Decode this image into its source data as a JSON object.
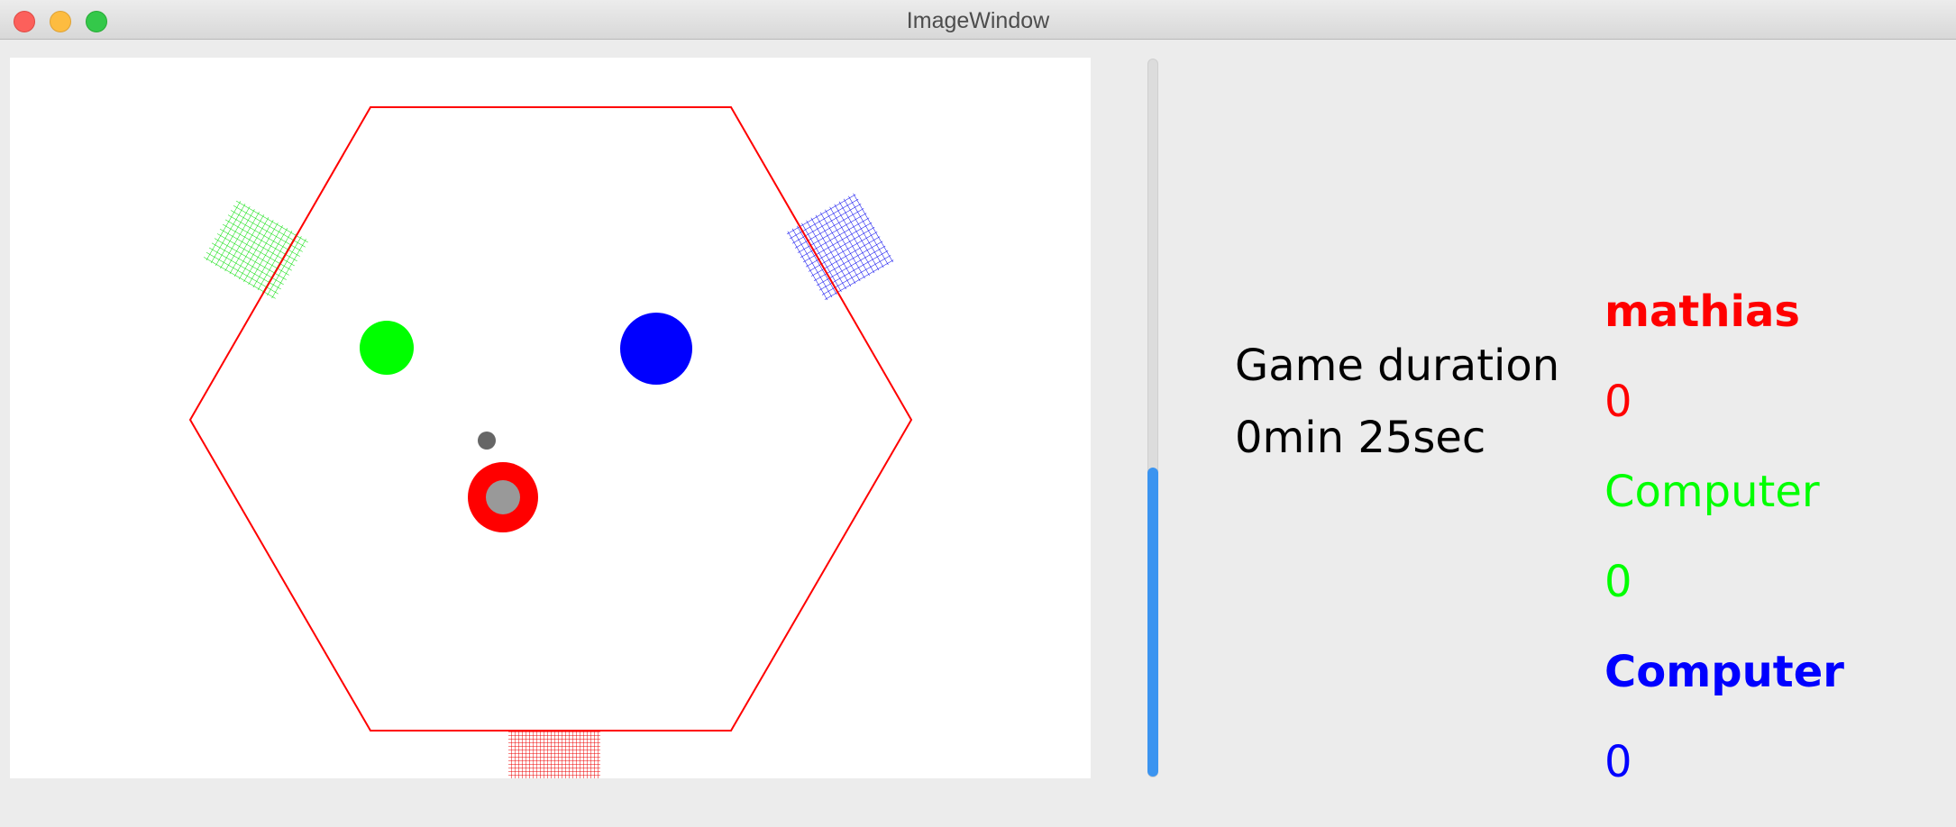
{
  "window": {
    "title": "ImageWindow"
  },
  "game": {
    "board_shape": "hexagon",
    "board_color": "#ff0000",
    "ball_color": "#666666",
    "players": [
      {
        "name": "mathias",
        "score": "0",
        "color": "#ff0000"
      },
      {
        "name": "Computer",
        "score": "0",
        "color": "#00ff00"
      },
      {
        "name": "Computer",
        "score": "0",
        "color": "#0000ff"
      }
    ]
  },
  "stats": {
    "duration_label": "Game duration",
    "duration_value": "0min 25sec"
  },
  "scrollbar": {
    "position_fraction": 0.57,
    "thumb_color": "#3b94f0"
  }
}
